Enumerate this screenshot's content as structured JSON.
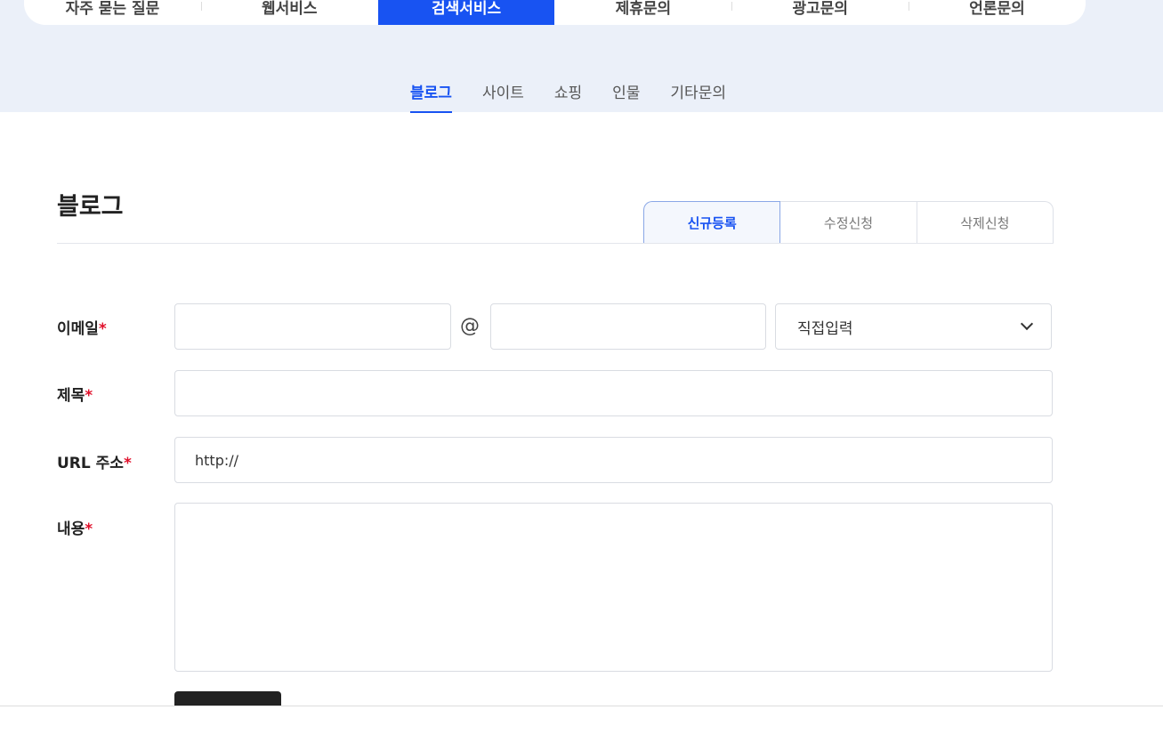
{
  "main_tabs": [
    {
      "label": "자주 묻는 질문",
      "active": false
    },
    {
      "label": "웹서비스",
      "active": false
    },
    {
      "label": "검색서비스",
      "active": true
    },
    {
      "label": "제휴문의",
      "active": false
    },
    {
      "label": "광고문의",
      "active": false
    },
    {
      "label": "언론문의",
      "active": false
    }
  ],
  "sub_tabs": [
    {
      "label": "블로그",
      "active": true
    },
    {
      "label": "사이트",
      "active": false
    },
    {
      "label": "쇼핑",
      "active": false
    },
    {
      "label": "인물",
      "active": false
    },
    {
      "label": "기타문의",
      "active": false
    }
  ],
  "section": {
    "title": "블로그"
  },
  "request_tabs": [
    {
      "label": "신규등록",
      "active": true
    },
    {
      "label": "수정신청",
      "active": false
    },
    {
      "label": "삭제신청",
      "active": false
    }
  ],
  "form": {
    "required_mark": "*",
    "email": {
      "label": "이메일",
      "local_value": "",
      "at_sign": "@",
      "domain_value": "",
      "domain_select": "직접입력"
    },
    "subject": {
      "label": "제목",
      "value": ""
    },
    "url": {
      "label": "URL 주소",
      "value": "http://"
    },
    "content": {
      "label": "내용",
      "value": ""
    }
  },
  "colors": {
    "accent": "#1853f2",
    "required": "#e0102b",
    "band": "#ebf0f9"
  }
}
